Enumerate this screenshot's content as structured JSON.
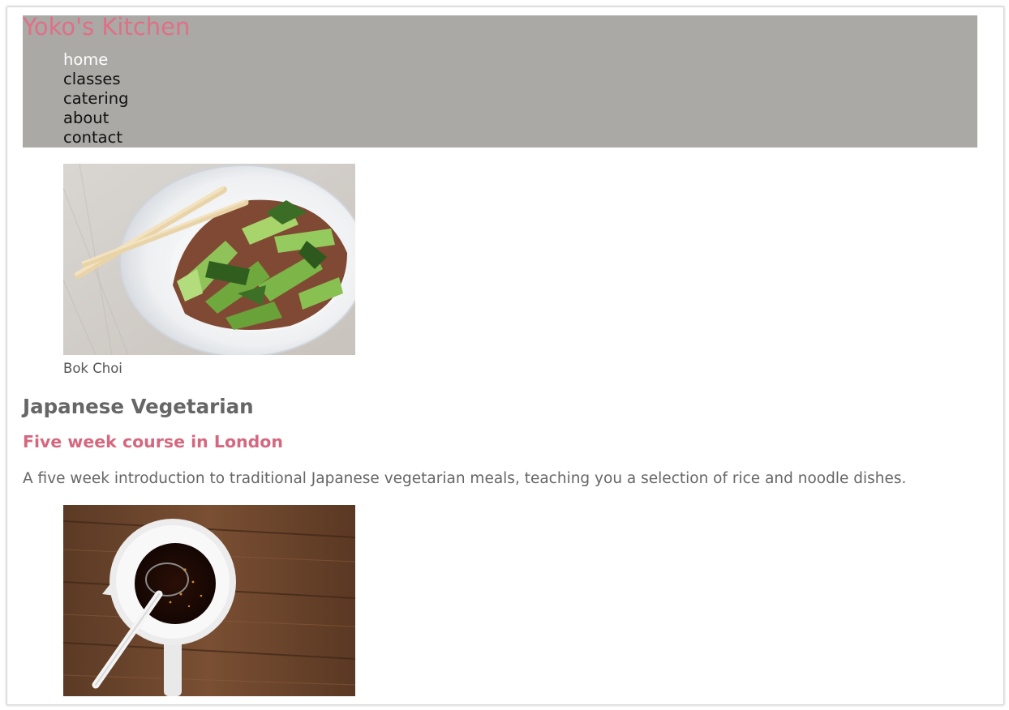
{
  "header": {
    "site_title": "Yoko's Kitchen",
    "nav": [
      {
        "label": "home",
        "active": true
      },
      {
        "label": "classes",
        "active": false
      },
      {
        "label": "catering",
        "active": false
      },
      {
        "label": "about",
        "active": false
      },
      {
        "label": "contact",
        "active": false
      }
    ]
  },
  "figures": [
    {
      "image": "bok-choi-photo",
      "caption": "Bok Choi"
    },
    {
      "image": "dressing-photo",
      "caption": ""
    }
  ],
  "article": {
    "heading": "Japanese Vegetarian",
    "subheading": "Five week course in London",
    "paragraph": "A five week introduction to traditional Japanese vegetarian meals, teaching you a selection of rice and noodle dishes."
  },
  "colors": {
    "header_background": "#aaa9a5",
    "accent": "#e16f86",
    "text": "#666666"
  }
}
